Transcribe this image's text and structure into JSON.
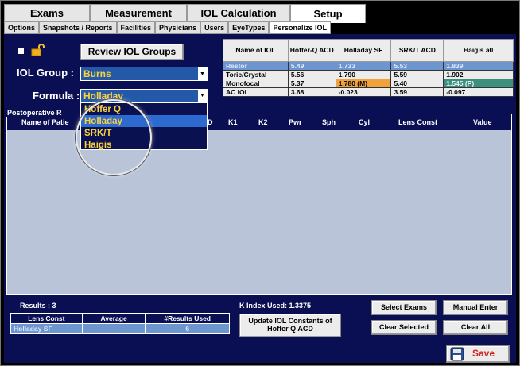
{
  "main_tabs": [
    "Exams",
    "Measurement",
    "IOL Calculation",
    "Setup"
  ],
  "sub_tabs": [
    "Options",
    "Snapshots / Reports",
    "Facilities",
    "Physicians",
    "Users",
    "EyeTypes",
    "Personalize IOL"
  ],
  "controls": {
    "review_button": "Review IOL Groups",
    "iol_group_label": "IOL Group :",
    "iol_group_value": "Burns",
    "formula_label": "Formula :",
    "formula_value": "Holladay"
  },
  "formula_options": [
    "Hoffer Q",
    "Holladay",
    "SRK/T",
    "Haigis"
  ],
  "iol_table": {
    "headers": [
      "Name of IOL",
      "Hoffer-Q ACD",
      "Holladay SF",
      "SRK/T ACD",
      "Haigis a0"
    ],
    "rows": [
      [
        "Restor",
        "5.49",
        "1.733",
        "5.53",
        "1.839"
      ],
      [
        "Toric/Crystal",
        "5.56",
        "1.790",
        "5.59",
        "1.902"
      ],
      [
        "Monofocal",
        "5.37",
        "1.780  (M)",
        "5.40",
        "1.545  (P)"
      ],
      [
        "AC IOL",
        "3.68",
        "-0.023",
        "3.59",
        "-0.097"
      ]
    ]
  },
  "post": {
    "title": "Postoperative R",
    "columns": [
      "Name of Patie",
      "D",
      "K1",
      "K2",
      "Pwr",
      "Sph",
      "Cyl",
      "Lens Const",
      "Value"
    ]
  },
  "results": {
    "count_label": "Results : 3",
    "headers": [
      "Lens Const",
      "Average",
      "#Results Used"
    ],
    "row": [
      "Holladay SF",
      "",
      "6"
    ]
  },
  "k_index": "K Index Used: 1.3375",
  "buttons": {
    "update": "Update IOL Constants of Hoffer Q ACD",
    "select_exams": "Select Exams",
    "manual_enter": "Manual Enter",
    "clear_selected": "Clear Selected",
    "clear_all": "Clear All",
    "save": "Save"
  },
  "colors": {
    "background": "#0a0e52",
    "selection": "#6d96cf",
    "highlight_orange": "#f0a23c",
    "highlight_teal": "#3d8f7e",
    "dropdown_text": "#ffd23a"
  }
}
